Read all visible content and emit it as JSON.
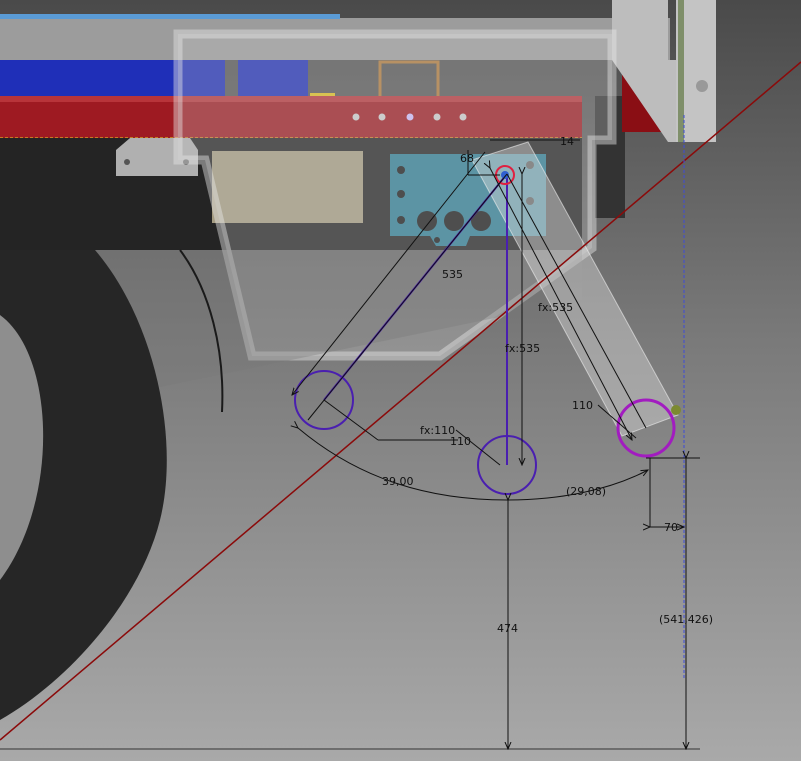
{
  "viewport": {
    "background_top": "#4a4a4a",
    "background_bottom": "#a9a9a9"
  },
  "colors": {
    "frame_red": "#9e1a22",
    "frame_blue": "#1f2fb8",
    "plate_teal": "#2f7f96",
    "sketch_purple": "#4a1fb0",
    "sketch_magenta": "#a21cc0",
    "axis_red": "#8b0a0a",
    "dim_line": "#111111"
  },
  "dimensions": {
    "d_68": "68",
    "d_14": "14",
    "d_535_top": "535",
    "d_fx535_right": "fx:535",
    "d_fx535_mid": "fx:535",
    "d_110_right": "110",
    "d_fx110": "fx:110",
    "d_110_left": "110",
    "d_angle_39": "39,00",
    "d_angle_29": "(29,08)",
    "d_70": "70",
    "d_474": "474",
    "d_541": "(541,426)"
  }
}
